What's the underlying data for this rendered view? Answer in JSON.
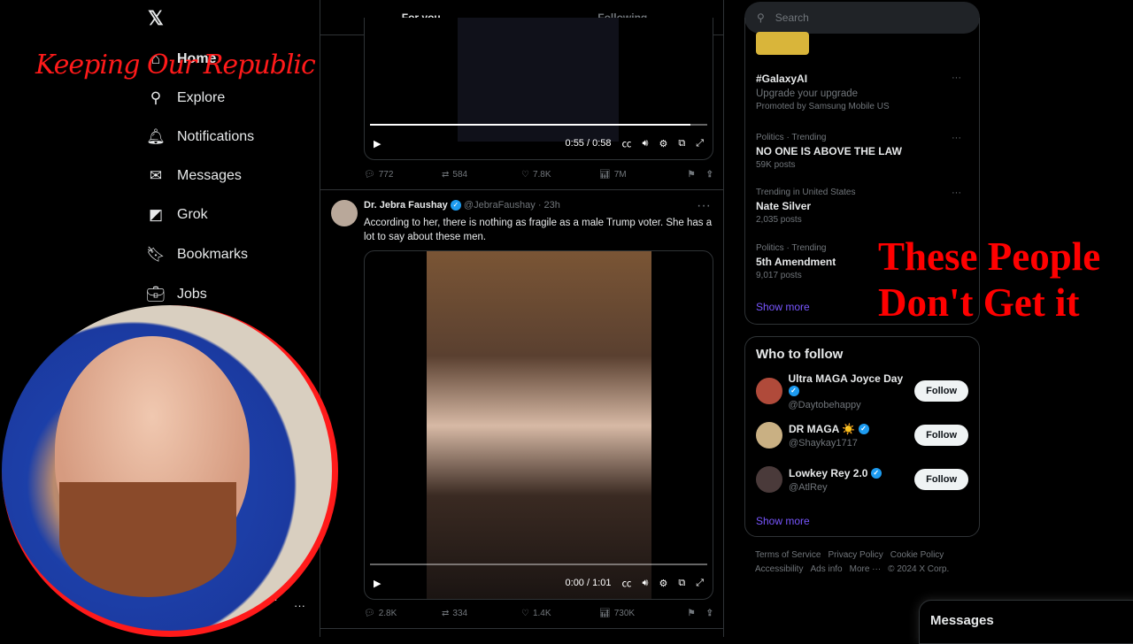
{
  "nav": {
    "items": [
      {
        "label": "Home",
        "icon": "home-icon"
      },
      {
        "label": "Explore",
        "icon": "search-icon"
      },
      {
        "label": "Notifications",
        "icon": "bell-icon"
      },
      {
        "label": "Messages",
        "icon": "mail-icon"
      },
      {
        "label": "Grok",
        "icon": "grok-icon"
      },
      {
        "label": "Bookmarks",
        "icon": "bookmark-icon"
      },
      {
        "label": "Jobs",
        "icon": "briefcase-icon"
      }
    ],
    "profile_partial": "an",
    "more": "···"
  },
  "overlay": {
    "channel": "Keeping Our Republic",
    "headline_1": "These People",
    "headline_2": "Don't Get it",
    "accent": "#ff0000"
  },
  "feed": {
    "tabs": [
      {
        "label": "For you"
      },
      {
        "label": "Following"
      }
    ],
    "post1": {
      "time": "0:55 / 0:58",
      "progress": 0.95,
      "replies": "772",
      "reposts": "584",
      "likes": "7.8K",
      "views": "7M"
    },
    "post2": {
      "name": "Dr. Jebra Faushay",
      "handle": "@JebraFaushay · 23h",
      "text": "According to her, there is nothing as fragile as a male Trump voter. She has a lot to say about these men.",
      "time": "0:00 / 1:01",
      "progress": 0,
      "replies": "2.8K",
      "reposts": "334",
      "likes": "1.4K",
      "views": "730K"
    }
  },
  "search": {
    "placeholder": "Search"
  },
  "trends": {
    "promo": {
      "title": "#GalaxyAI",
      "sub": "Upgrade your upgrade",
      "by": "Promoted by Samsung Mobile US"
    },
    "items": [
      {
        "meta": "Politics · Trending",
        "title": "NO ONE IS ABOVE THE LAW",
        "count": "59K posts"
      },
      {
        "meta": "Trending in United States",
        "title": "Nate Silver",
        "count": "2,035 posts"
      },
      {
        "meta": "Politics · Trending",
        "title": "5th Amendment",
        "count": "9,017 posts"
      }
    ],
    "show_more": "Show more"
  },
  "who_to_follow": {
    "title": "Who to follow",
    "users": [
      {
        "name": "Ultra MAGA Joyce Day",
        "handle": "@Daytobehappy",
        "button": "Follow"
      },
      {
        "name": "DR MAGA ☀️",
        "handle": "@Shaykay1717",
        "button": "Follow"
      },
      {
        "name": "Lowkey Rey 2.0",
        "handle": "@AtlRey",
        "button": "Follow"
      }
    ],
    "show_more": "Show more"
  },
  "footer": {
    "links": [
      "Terms of Service",
      "Privacy Policy",
      "Cookie Policy",
      "Accessibility",
      "Ads info",
      "More ···",
      "© 2024 X Corp."
    ]
  },
  "messages": {
    "title": "Messages"
  }
}
